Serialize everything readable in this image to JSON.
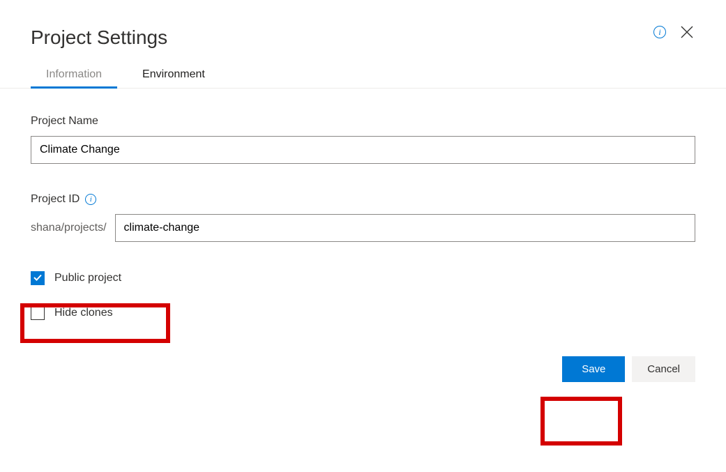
{
  "title": "Project Settings",
  "tabs": {
    "information": "Information",
    "environment": "Environment"
  },
  "fields": {
    "project_name_label": "Project Name",
    "project_name_value": "Climate Change",
    "project_id_label": "Project ID",
    "project_id_prefix": "shana/projects/",
    "project_id_value": "climate-change"
  },
  "checkboxes": {
    "public_label": "Public project",
    "public_checked": true,
    "hide_clones_label": "Hide clones",
    "hide_clones_checked": false
  },
  "buttons": {
    "save": "Save",
    "cancel": "Cancel"
  }
}
